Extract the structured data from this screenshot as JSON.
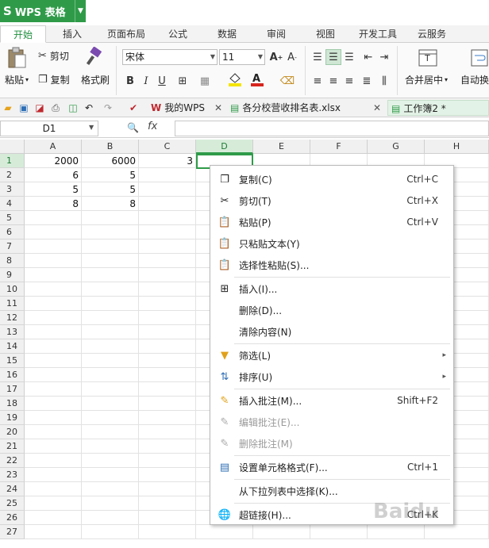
{
  "app": {
    "name": "WPS 表格"
  },
  "tabs": [
    "开始",
    "插入",
    "页面布局",
    "公式",
    "数据",
    "审阅",
    "视图",
    "开发工具",
    "云服务"
  ],
  "ribbon": {
    "paste": "粘贴",
    "cut": "剪切",
    "copy": "复制",
    "format_painter": "格式刷",
    "font_name": "宋体",
    "font_size": "11",
    "merge_center": "合并居中",
    "auto_wrap": "自动换"
  },
  "doc_tabs": [
    "我的WPS",
    "各分校营收排名表.xlsx",
    "工作簿2 *"
  ],
  "formula_bar": {
    "name_box": "D1",
    "fx": "fx",
    "value": ""
  },
  "columns": [
    "A",
    "B",
    "C",
    "D",
    "E",
    "F",
    "G",
    "H"
  ],
  "rows": [
    "1",
    "2",
    "3",
    "4",
    "5",
    "6",
    "7",
    "8",
    "9",
    "10",
    "11",
    "12",
    "13",
    "14",
    "15",
    "16",
    "17",
    "18",
    "19",
    "20",
    "21",
    "22",
    "23",
    "24",
    "25",
    "26",
    "27"
  ],
  "cells": {
    "A1": "2000",
    "B1": "6000",
    "C1": "3",
    "A2": "6",
    "B2": "5",
    "A3": "5",
    "B3": "5",
    "A4": "8",
    "B4": "8"
  },
  "context_menu": {
    "copy": {
      "label": "复制(C)",
      "shortcut": "Ctrl+C"
    },
    "cut": {
      "label": "剪切(T)",
      "shortcut": "Ctrl+X"
    },
    "paste": {
      "label": "粘贴(P)",
      "shortcut": "Ctrl+V"
    },
    "paste_text": {
      "label": "只粘贴文本(Y)"
    },
    "paste_special": {
      "label": "选择性粘贴(S)..."
    },
    "insert": {
      "label": "插入(I)..."
    },
    "delete": {
      "label": "删除(D)..."
    },
    "clear": {
      "label": "清除内容(N)"
    },
    "filter": {
      "label": "筛选(L)"
    },
    "sort": {
      "label": "排序(U)"
    },
    "insert_comment": {
      "label": "插入批注(M)...",
      "shortcut": "Shift+F2"
    },
    "edit_comment": {
      "label": "编辑批注(E)..."
    },
    "delete_comment": {
      "label": "删除批注(M)"
    },
    "format_cells": {
      "label": "设置单元格格式(F)...",
      "shortcut": "Ctrl+1"
    },
    "pick_list": {
      "label": "从下拉列表中选择(K)..."
    },
    "hyperlink": {
      "label": "超链接(H)...",
      "shortcut": "Ctrl+K"
    }
  },
  "watermark": "Baidu",
  "colors": {
    "accent": "#2f9b49",
    "annotation_arrow": "#c0282e"
  }
}
